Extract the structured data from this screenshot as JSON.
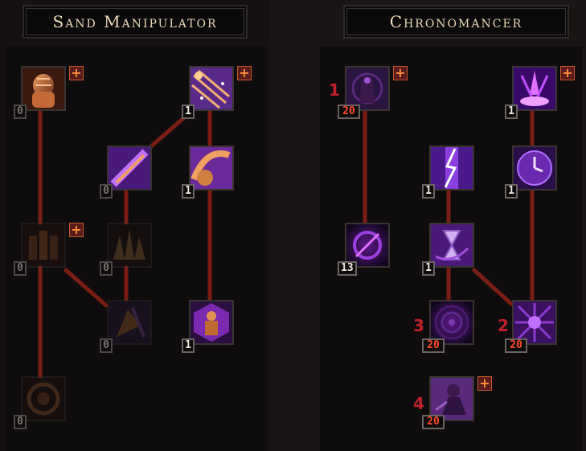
{
  "trees": {
    "left": {
      "title": "Sand Manipulator",
      "nodes": [
        {
          "key": "l1",
          "name": "sand-golem-skill",
          "count": "0",
          "plus": true
        },
        {
          "key": "l2",
          "name": "sand-burst-skill",
          "count": "1",
          "plus": true
        },
        {
          "key": "l3",
          "name": "sand-slash-skill",
          "count": "0"
        },
        {
          "key": "l4",
          "name": "sand-wave-skill",
          "count": "1"
        },
        {
          "key": "l5",
          "name": "sand-soldiers-skill",
          "count": "0",
          "plus": true
        },
        {
          "key": "l6",
          "name": "sand-spikes-skill",
          "count": "0"
        },
        {
          "key": "l7",
          "name": "sand-guard-skill",
          "count": "0"
        },
        {
          "key": "l8",
          "name": "sand-warrior-skill",
          "count": "1"
        },
        {
          "key": "l9",
          "name": "sand-vortex-skill",
          "count": "0"
        }
      ]
    },
    "right": {
      "title": "Chronomancer",
      "nodes": [
        {
          "key": "r1",
          "name": "time-reaper-skill",
          "count": "20",
          "plus": true,
          "order": "1"
        },
        {
          "key": "r2",
          "name": "time-rift-skill",
          "count": "1",
          "plus": true
        },
        {
          "key": "r3",
          "name": "time-lightning-skill",
          "count": "1"
        },
        {
          "key": "r4",
          "name": "clock-skill",
          "count": "1"
        },
        {
          "key": "r5",
          "name": "time-storm-skill",
          "count": "13"
        },
        {
          "key": "r6",
          "name": "hourglass-skill",
          "count": "1"
        },
        {
          "key": "r7",
          "name": "time-vortex-skill",
          "count": "20",
          "order": "3"
        },
        {
          "key": "r8",
          "name": "time-field-skill",
          "count": "20",
          "order": "2"
        },
        {
          "key": "r9",
          "name": "time-clone-skill",
          "count": "20",
          "plus": true,
          "order": "4"
        }
      ]
    }
  },
  "plus_symbol": "+",
  "colors": {
    "link": "#7a1d12",
    "max_count": "#ff4a2c",
    "order": "#c0202a",
    "plus_bg": "#5a1c1a"
  }
}
